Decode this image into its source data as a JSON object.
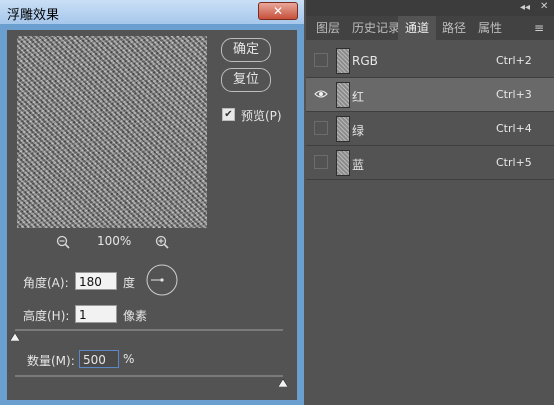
{
  "dialog": {
    "title": "浮雕效果",
    "close_label": "✕",
    "ok_label": "确定",
    "reset_label": "复位",
    "preview_label": "预览(P)",
    "preview_checked": true,
    "zoom_level": "100%",
    "angle_label": "角度(A):",
    "angle_value": "180",
    "angle_unit": "度",
    "height_label": "高度(H):",
    "height_value": "1",
    "height_unit": "像素",
    "amount_label": "数量(M):",
    "amount_value": "500",
    "amount_unit": "%",
    "height_slider_fraction": 0.0,
    "amount_slider_fraction": 1.0
  },
  "panel": {
    "collapse_label": "◂◂",
    "close_label": "✕",
    "menu_label": "≡",
    "tabs": [
      {
        "label": "图层",
        "active": false
      },
      {
        "label": "历史记录",
        "active": false
      },
      {
        "label": "通道",
        "active": true
      },
      {
        "label": "路径",
        "active": false
      },
      {
        "label": "属性",
        "active": false
      }
    ],
    "channels": [
      {
        "name": "RGB",
        "shortcut": "Ctrl+2",
        "visible": false,
        "selected": false
      },
      {
        "name": "红",
        "shortcut": "Ctrl+3",
        "visible": true,
        "selected": true
      },
      {
        "name": "绿",
        "shortcut": "Ctrl+4",
        "visible": false,
        "selected": false
      },
      {
        "name": "蓝",
        "shortcut": "Ctrl+5",
        "visible": false,
        "selected": false
      }
    ]
  },
  "icons": {
    "eye": "eye-icon",
    "zoom_out": "zoom-out-icon",
    "zoom_in": "zoom-in-icon",
    "check": "checkmark-icon"
  },
  "colors": {
    "panel_bg": "#535353",
    "selected_row": "#696969",
    "title_bar": "#a7c8ec",
    "close_button": "#c7503a"
  }
}
